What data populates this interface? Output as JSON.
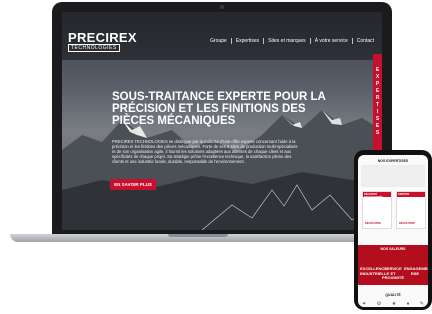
{
  "laptop": {
    "header": {
      "logo": "PRECIREX",
      "logo_sub": "TECHNOLOGIES",
      "nav": [
        "Groupe",
        "Expertises",
        "Sites et marques",
        "À votre service",
        "Contact"
      ]
    },
    "hero": {
      "title": "SOUS-TRAITANCE EXPERTE POUR LA PRÉCISION ET LES FINITIONS DES PIÈCES MÉCANIQUES",
      "text": "PRECIREX TECHNOLOGIES se distingue par la maîtrise d'une offre experte concernant l'aide à la précision et les finitions des pièces mécaniques. Forte de ses 5 sites de production multi-spécialisés et de son organisation agile, il fournit les solutions adaptées aux attentes de chaque client et aux spécificités de chaque projet. Sa stratégie prône l'excellence technique, la satisfaction pleine des clients et une industrie locale, durable, responsable de l'environnement.",
      "cta": "EN SAVOIR PLUS"
    },
    "side_tab": "EXPERTISES"
  },
  "phone": {
    "title": "NOS EXPERTISES",
    "cards": [
      "SÉCURITÉ PROGRAMMÉE",
      "FINITION"
    ],
    "card_links": [
      "DÉCOUVRIR",
      "DÉCOUVRIR"
    ],
    "values_title": "NOS VALEURS",
    "values": [
      "EXCELLENCE INDUSTRIELLE",
      "SERVICE ET PROXIMITÉ",
      "ENGAGEMENT RSE"
    ],
    "quality_title": "QUALITÉ",
    "icons": [
      "✦",
      "⚙",
      "★",
      "♦",
      "✎"
    ]
  },
  "colors": {
    "accent": "#c8102e"
  }
}
